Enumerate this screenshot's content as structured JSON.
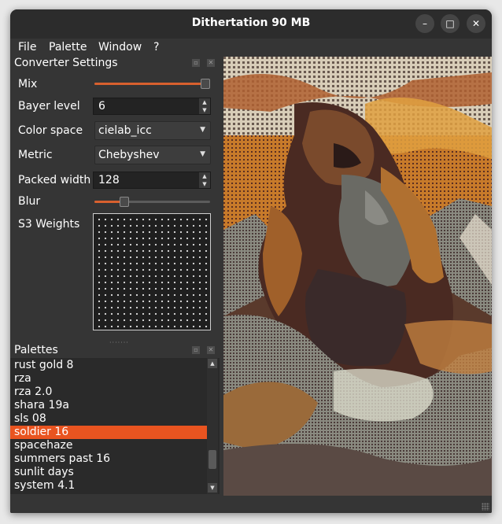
{
  "window": {
    "title": "Dithertation 90 MB",
    "controls": {
      "minimize": "–",
      "maximize": "□",
      "close": "✕"
    }
  },
  "menu": [
    "File",
    "Palette",
    "Window",
    "?"
  ],
  "converter": {
    "header": "Converter Settings",
    "mix_label": "Mix",
    "mix_value": 0.97,
    "bayer_label": "Bayer level",
    "bayer_value": "6",
    "color_space_label": "Color space",
    "color_space_value": "cielab_icc",
    "metric_label": "Metric",
    "metric_value": "Chebyshev",
    "packed_width_label": "Packed width",
    "packed_width_value": "128",
    "blur_label": "Blur",
    "blur_value": 0.25,
    "s3_weights_label": "S3 Weights"
  },
  "palettes": {
    "header": "Palettes",
    "items": [
      "rust gold 8",
      "rza",
      "rza 2.0",
      "shara 19a",
      "sls 08",
      "soldier 16",
      "spacehaze",
      "summers past 16",
      "sunlit days",
      "system 4.1"
    ],
    "selected_index": 5
  },
  "colors": {
    "accent": "#e95420",
    "slider_fill": "#d8602e",
    "window_bg": "#353535",
    "titlebar_bg": "#2c2c2c"
  },
  "icons": {
    "dock_float": "float-icon",
    "dock_close": "close-icon",
    "spin_up": "arrow-up-icon",
    "spin_down": "arrow-down-icon",
    "combo": "chevron-down-icon"
  }
}
